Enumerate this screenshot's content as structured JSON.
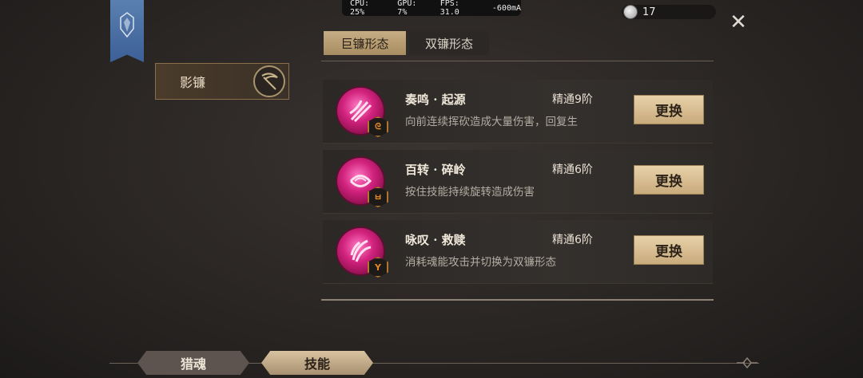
{
  "perf": {
    "cpu": "CPU: 25%",
    "gpu": "GPU: 7%",
    "fps": "FPS: 31.0",
    "current": "-600mA"
  },
  "currency": {
    "icon": "silver-coin-icon",
    "count": "17"
  },
  "close": {
    "icon": "close-icon",
    "glyph": "✕"
  },
  "weapon": {
    "label": "影镰",
    "icon": "scythe-icon"
  },
  "tabs": [
    {
      "label": "巨镰形态",
      "active": true
    },
    {
      "label": "双镰形态",
      "active": false
    }
  ],
  "skills": [
    {
      "name": "奏鸣 · 起源",
      "level": "精通9阶",
      "desc": "向前连续挥砍造成大量伤害，回复生",
      "button": "更换",
      "icon": "slash-skill-icon",
      "rune_icon": "rune-icon"
    },
    {
      "name": "百转 · 碎岭",
      "level": "精通6阶",
      "desc": "按住技能持续旋转造成伤害",
      "button": "更换",
      "icon": "spin-skill-icon",
      "rune_icon": "rune-icon"
    },
    {
      "name": "咏叹 · 救赎",
      "level": "精通6阶",
      "desc": "消耗魂能攻击并切换为双镰形态",
      "button": "更换",
      "icon": "claw-skill-icon",
      "rune_icon": "rune-icon"
    }
  ],
  "bottom_nav": [
    {
      "label": "猎魂",
      "active": false
    },
    {
      "label": "技能",
      "active": true
    }
  ],
  "colors": {
    "accent_gold": "#c9ab7d",
    "skill_magenta": "#d2237e",
    "banner_blue": "#3c6097"
  }
}
